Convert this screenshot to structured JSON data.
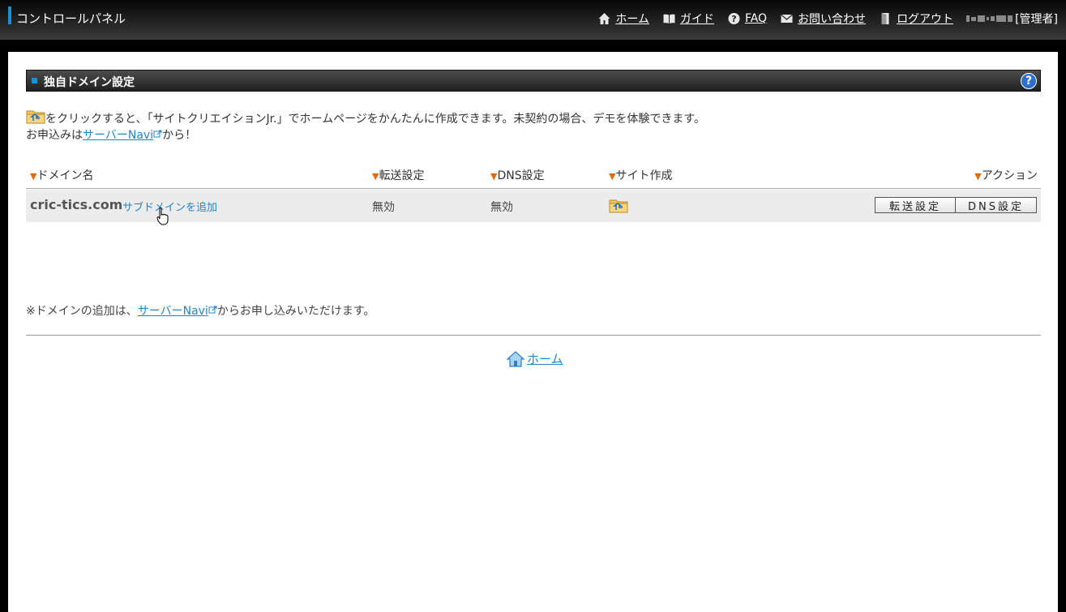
{
  "header": {
    "brand": "コントロールパネル",
    "nav": [
      {
        "icon": "home-icon",
        "label": "ホーム"
      },
      {
        "icon": "book-icon",
        "label": "ガイド"
      },
      {
        "icon": "question-icon",
        "label": "FAQ"
      },
      {
        "icon": "mail-icon",
        "label": "お問い合わせ"
      },
      {
        "icon": "logout-icon",
        "label": "ログアウト"
      }
    ],
    "user_role": "[管理者]"
  },
  "section": {
    "title": "独自ドメイン設定",
    "help_icon": "?"
  },
  "intro": {
    "line1": "をクリックすると、「サイトクリエイションJr.」でホームページをかんたんに作成できます。未契約の場合、デモを体験できます。",
    "line2_prefix": "お申込みは",
    "line2_link": "サーバーNavi",
    "line2_suffix": "から！"
  },
  "table": {
    "headers": [
      "ドメイン名",
      "転送設定",
      "DNS設定",
      "サイト作成",
      "アクション"
    ],
    "rows": [
      {
        "domain": "cric-tics.com",
        "subdomain_link": "サブドメインを追加",
        "forwarding": "無効",
        "dns": "無効",
        "actions": [
          "転送設定",
          "DNS設定"
        ]
      }
    ]
  },
  "note": {
    "prefix": "※ドメインの追加は、",
    "link": "サーバーNavi",
    "suffix": "からお申し込みいただけます。"
  },
  "footer": {
    "home_label": "ホーム"
  },
  "colors": {
    "accent": "#1e8fd6",
    "link": "#1f86c8",
    "sort_triangle": "#e06a10",
    "help_button": "#2f6fc9"
  }
}
